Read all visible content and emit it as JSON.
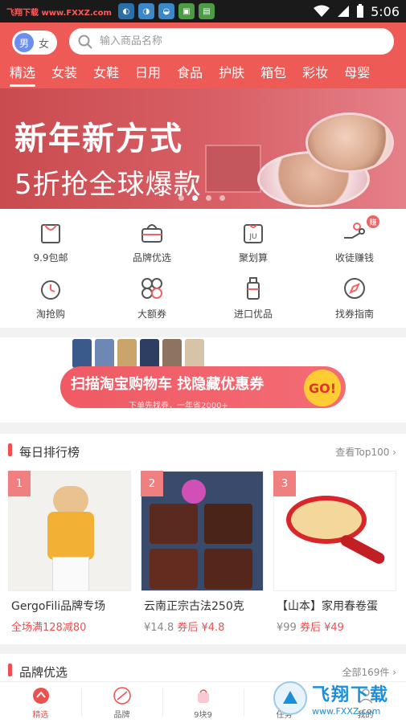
{
  "status_bar": {
    "site_label": "飞翔下载 www.FXXZ.com",
    "time": "5:06",
    "notification_icons": [
      "app-icon",
      "app-icon",
      "app-icon",
      "app-icon",
      "app-icon"
    ]
  },
  "header": {
    "gender": {
      "male": "男",
      "female": "女"
    },
    "search_placeholder": "输入商品名称",
    "categories": [
      "精选",
      "女装",
      "女鞋",
      "日用",
      "食品",
      "护肤",
      "箱包",
      "彩妆",
      "母婴"
    ],
    "active_category": "精选"
  },
  "banner": {
    "line1": "新年新方式",
    "line2": "5折抢全球爆款",
    "slides": 4,
    "active_slide": 1
  },
  "quick_links": [
    {
      "label": "9.9包邮",
      "icon": "shopping-bag-icon"
    },
    {
      "label": "品牌优选",
      "icon": "handbag-icon"
    },
    {
      "label": "聚划算",
      "icon": "ju-bag-icon"
    },
    {
      "label": "收徒赚钱",
      "icon": "coins-hand-icon",
      "badge": "赚"
    },
    {
      "label": "淘抢购",
      "icon": "alarm-clock-icon"
    },
    {
      "label": "大额券",
      "icon": "clover-icon"
    },
    {
      "label": "进口优品",
      "icon": "bottle-icon"
    },
    {
      "label": "找券指南",
      "icon": "compass-icon"
    }
  ],
  "promo": {
    "title": "扫描淘宝购物车  找隐藏优惠券",
    "subtitle": "下单先找券，一年省2000+",
    "go_label": "GO!"
  },
  "ranking": {
    "title": "每日排行榜",
    "more": "查看Top100",
    "products": [
      {
        "rank": "1",
        "name": "GergoFili品牌专场",
        "price_old": "",
        "price_new": "",
        "promo": "全场满128减80"
      },
      {
        "rank": "2",
        "name": "云南正宗古法250克",
        "price_old": "¥14.8",
        "price_new": "券后 ¥4.8",
        "promo": ""
      },
      {
        "rank": "3",
        "name": "【山本】家用春卷蛋",
        "price_old": "¥99",
        "price_new": "券后 ¥49",
        "promo": ""
      }
    ]
  },
  "brand_section": {
    "title": "品牌优选",
    "more": "全部169件"
  },
  "bottom_nav": [
    {
      "label": "精选",
      "icon": "home-icon",
      "active": true
    },
    {
      "label": "品牌",
      "icon": "brand-icon",
      "active": false
    },
    {
      "label": "9块9",
      "icon": "bag-icon",
      "active": false
    },
    {
      "label": "任务",
      "icon": "task-icon",
      "active": false
    },
    {
      "label": "我的",
      "icon": "user-icon",
      "active": false
    }
  ],
  "watermark": {
    "title": "飞翔下载",
    "url": "www.FXXZ.com"
  },
  "colors": {
    "brand_red": "#ee5b57",
    "accent_red": "#ee4f4f",
    "banner_red": "#d0555a"
  }
}
